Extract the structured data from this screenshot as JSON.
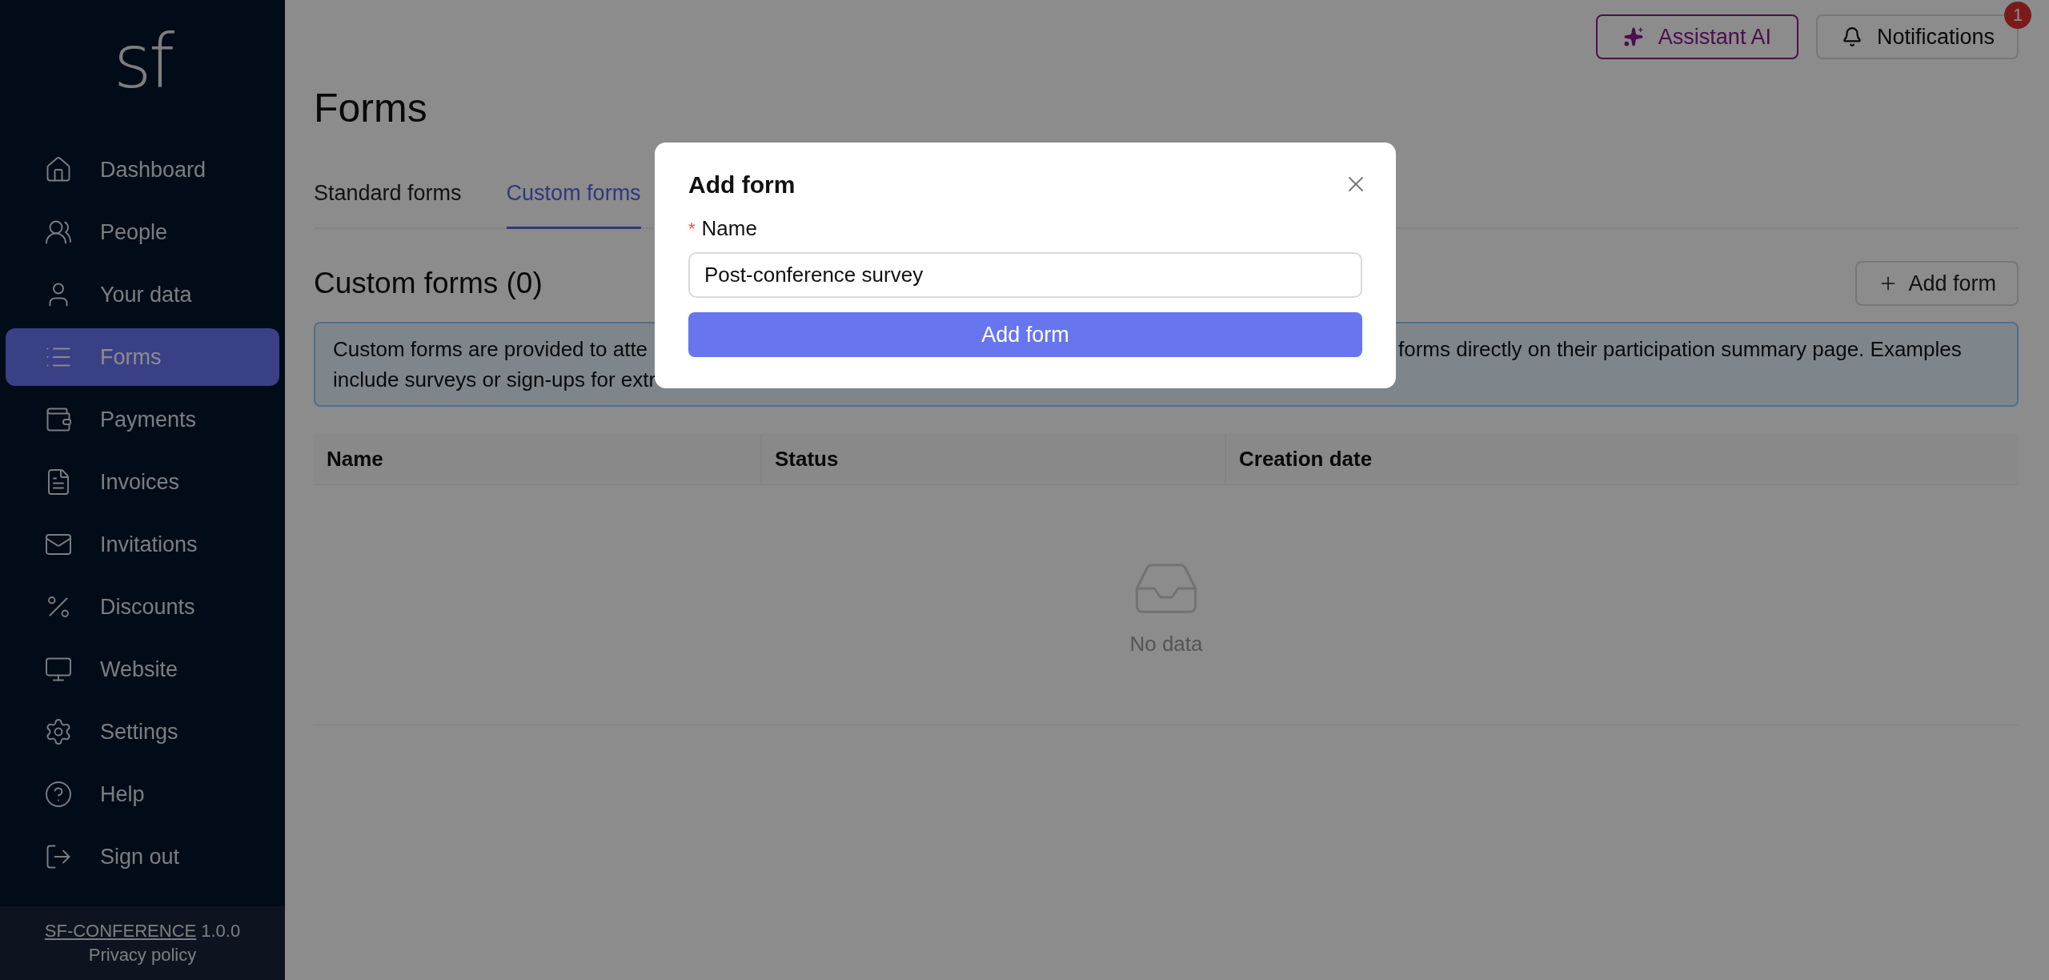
{
  "sidebar": {
    "logo": "sf",
    "items": [
      {
        "label": "Dashboard",
        "selected": false
      },
      {
        "label": "People",
        "selected": false
      },
      {
        "label": "Your data",
        "selected": false
      },
      {
        "label": "Forms",
        "selected": true
      },
      {
        "label": "Payments",
        "selected": false
      },
      {
        "label": "Invoices",
        "selected": false
      },
      {
        "label": "Invitations",
        "selected": false
      },
      {
        "label": "Discounts",
        "selected": false
      },
      {
        "label": "Website",
        "selected": false
      },
      {
        "label": "Settings",
        "selected": false
      }
    ],
    "bottom_items": [
      {
        "label": "Help",
        "selected": false
      },
      {
        "label": "Sign out",
        "selected": false
      }
    ],
    "footer": {
      "product_link": "SF-CONFERENCE",
      "version": "1.0.0",
      "privacy_link": "Privacy policy"
    }
  },
  "header": {
    "assistant_button": "Assistant AI",
    "notifications_button": "Notifications",
    "notifications_badge": "1"
  },
  "page": {
    "title": "Forms",
    "tabs": [
      {
        "label": "Standard forms",
        "selected": false
      },
      {
        "label": "Custom forms",
        "selected": true
      }
    ],
    "section_title": "Custom forms (0)",
    "add_button": "Add form",
    "info_lines": [
      {
        "left": "Custom forms are provided to atte",
        "right": "forms directly on their participation summary page. Examples"
      },
      {
        "left": "include surveys or sign-ups for extr"
      }
    ],
    "table": {
      "columns": [
        "Name",
        "Status",
        "Creation date"
      ],
      "empty_text": "No data"
    }
  },
  "modal": {
    "title": "Add form",
    "field_label": "Name",
    "required_mark": "*",
    "field_value": "Post-conference survey",
    "submit_button": "Add form"
  }
}
